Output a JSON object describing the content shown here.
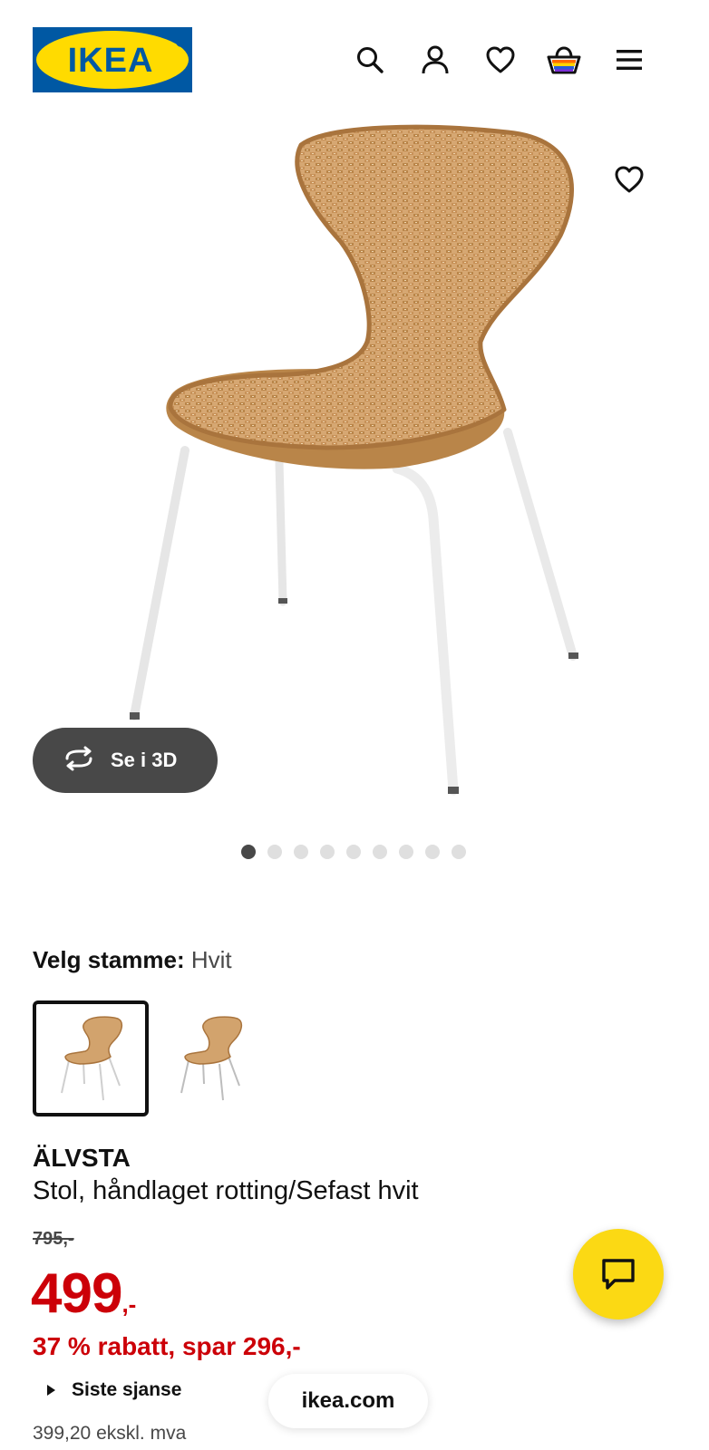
{
  "brand": {
    "logo_text": "IKEA",
    "colors": {
      "blue": "#0058a3",
      "yellow": "#ffdb00"
    }
  },
  "header": {
    "icons": [
      "search-icon",
      "account-icon",
      "heart-icon",
      "shopping-bag-icon",
      "menu-icon"
    ]
  },
  "gallery": {
    "view_3d_label": "Se i 3D",
    "image_count": 9,
    "active_index": 0
  },
  "variant": {
    "label": "Velg stamme:",
    "value": "Hvit",
    "options_count": 2,
    "selected_index": 0
  },
  "product": {
    "name": "ÄLVSTA",
    "description": "Stol, håndlaget rotting/Sefast hvit",
    "old_price": "795,-",
    "price_main": "499",
    "price_suffix": ",-",
    "discount_text": "37 % rabatt, spar 296,-",
    "last_chance_label": "Siste sjanse",
    "price_ex_vat": "399,20 ekskl. mva"
  },
  "footer": {
    "url": "ikea.com"
  },
  "colors": {
    "price_red": "#cc0008",
    "chat_yellow": "#fbd914",
    "dark_gray": "#484848"
  }
}
